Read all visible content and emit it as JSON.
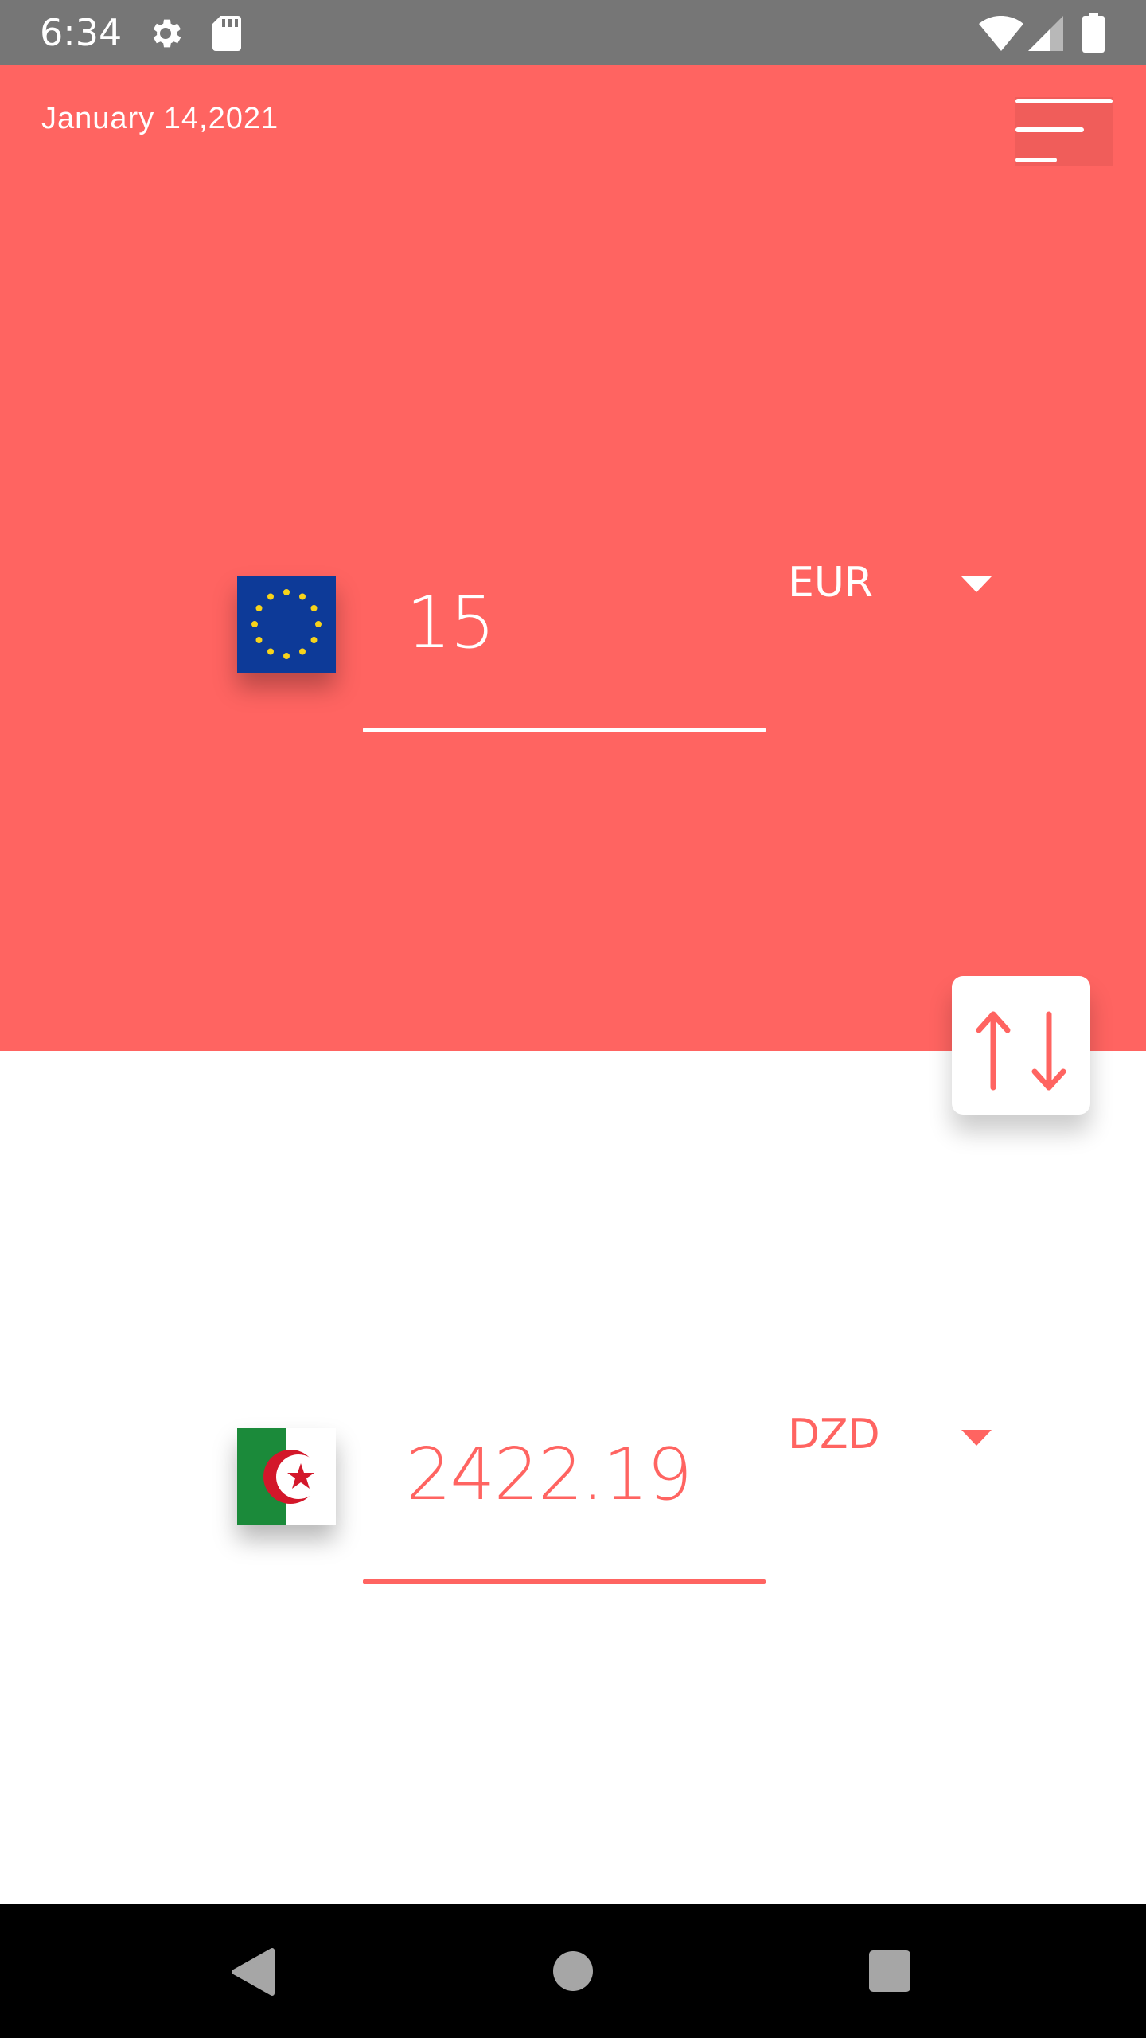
{
  "status_bar": {
    "time": "6:34",
    "icons": [
      "gear-icon",
      "sd-card-icon",
      "wifi-icon",
      "signal-icon",
      "battery-icon"
    ]
  },
  "header": {
    "date": "January 14,2021",
    "menu_icon": "hamburger-menu-icon"
  },
  "from_currency": {
    "flag": "eu-flag-icon",
    "amount": "15",
    "code": "EUR"
  },
  "to_currency": {
    "flag": "algeria-flag-icon",
    "amount": "2422.19",
    "code": "DZD"
  },
  "swap": {
    "icon": "swap-arrows-icon"
  },
  "nav_bar": {
    "icons": [
      "back-icon",
      "home-icon",
      "recents-icon"
    ]
  },
  "colors": {
    "accent": "#ff6461",
    "status_bar": "#767676",
    "nav_bar": "#000000",
    "background": "#ffffff"
  }
}
